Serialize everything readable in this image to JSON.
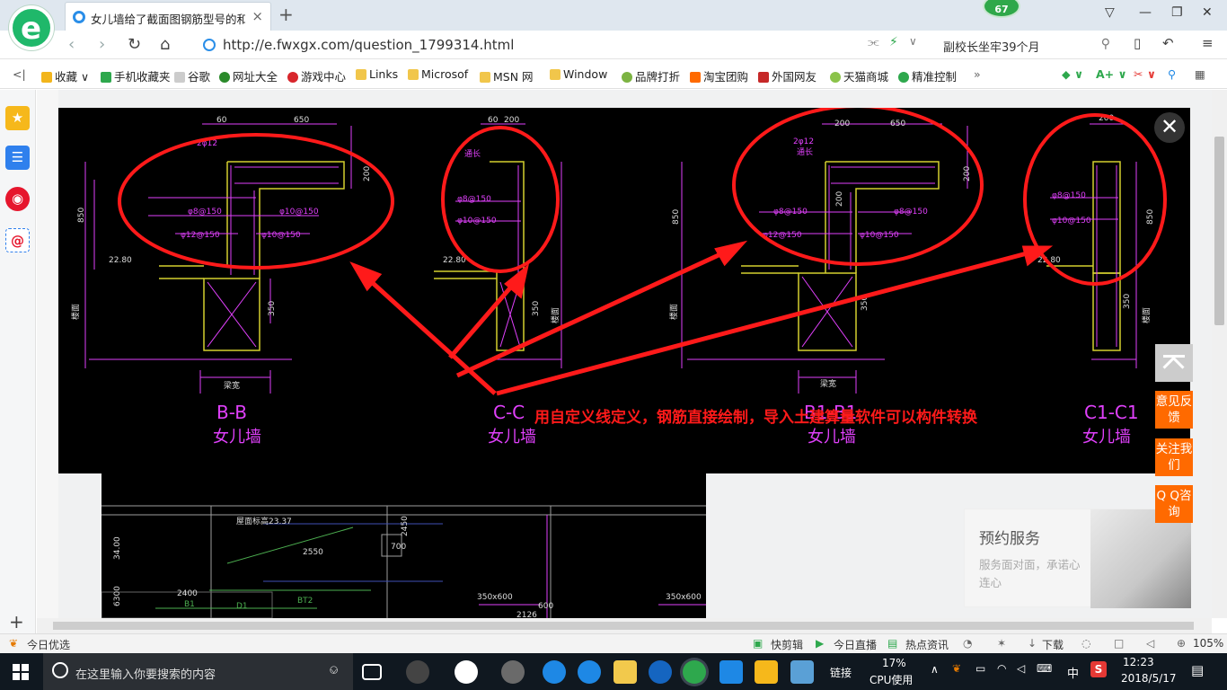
{
  "tab": {
    "title": "女儿墙给了截面图钢筋型号的和",
    "close": "×",
    "new": "+"
  },
  "badge": "67",
  "address": {
    "url": "http://e.fwxgx.com/question_1799314.html",
    "search_text": "副校长坐牢39个月"
  },
  "bookmarks": [
    {
      "label": "收藏",
      "color": "#f2b51c"
    },
    {
      "label": "手机收藏夹",
      "color": "#2ea84d"
    },
    {
      "label": "谷歌",
      "color": "#888888"
    },
    {
      "label": "网址大全",
      "color": "#2b8a2b"
    },
    {
      "label": "游戏中心",
      "color": "#d8262c"
    },
    {
      "label": "Links",
      "color": "#f1c64b"
    },
    {
      "label": "Microsof",
      "color": "#f1c64b"
    },
    {
      "label": "MSN 网",
      "color": "#f1c64b"
    },
    {
      "label": "Window",
      "color": "#f1c64b"
    },
    {
      "label": "品牌打折",
      "color": "#7cb342"
    },
    {
      "label": "淘宝团购",
      "color": "#ff6a00"
    },
    {
      "label": "外国网友",
      "color": "#c62828"
    },
    {
      "label": "天猫商城",
      "color": "#8bc34a"
    },
    {
      "label": "精准控制",
      "color": "#2ea84d"
    }
  ],
  "bookmarks_more": "»",
  "drawings": {
    "section_labels": [
      "B-B",
      "C-C",
      "B1-B1",
      "C1-C1"
    ],
    "wall_label": "女儿墙",
    "beam_label": "梁宽",
    "dims": {
      "d60": "60",
      "d200": "200",
      "d650": "650",
      "d850": "850",
      "d350": "350",
      "d2280": "22.80",
      "phi8_150": "φ8@150",
      "phi10_150": "φ10@150",
      "phi12_150": "φ12@150",
      "two_phi12": "2φ12",
      "tong_chang": "通长",
      "lou_mian": "楼面"
    },
    "annotation": "用自定义线定义，钢筋直接绘制，导入土建算量软件可以构件转换",
    "lower": {
      "l1": "34.00",
      "l2": "6300",
      "l3": "2400",
      "l4": "2550",
      "l5": "2126",
      "l6": "2450",
      "l7": "700",
      "l8": "600",
      "l9": "350x600",
      "l10": "350x600",
      "l11": "D1",
      "l12": "B1",
      "l13": "BT2",
      "l14": "屋面标高23.37"
    }
  },
  "float_buttons": {
    "feedback": "意见反馈",
    "follow": "关注我们",
    "qq": "Q Q咨询"
  },
  "service": {
    "title": "预约服务",
    "desc": "服务面对面，承诺心连心"
  },
  "status": {
    "left": "今日优选",
    "kuaijianji": "快剪辑",
    "live": "今日直播",
    "news": "热点资讯",
    "download": "下载",
    "zoom": "105%"
  },
  "taskbar": {
    "search_placeholder": "在这里输入你要搜索的内容",
    "link": "链接",
    "cpu_pct": "17%",
    "cpu_label": "CPU使用",
    "ime": "中",
    "time": "12:23",
    "date": "2018/5/17"
  }
}
